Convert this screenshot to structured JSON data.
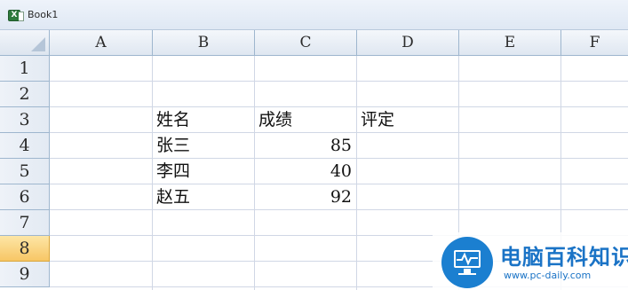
{
  "window": {
    "title": "Book1",
    "icon": "excel-workbook-icon"
  },
  "columns": [
    "A",
    "B",
    "C",
    "D",
    "E",
    "F"
  ],
  "rows": [
    "1",
    "2",
    "3",
    "4",
    "5",
    "6",
    "7",
    "8",
    "9"
  ],
  "active_row": "8",
  "cells": {
    "B3": "姓名",
    "C3": "成绩",
    "D3": "评定",
    "B4": "张三",
    "C4": "85",
    "B5": "李四",
    "C5": "40",
    "B6": "赵五",
    "C6": "92"
  },
  "watermark": {
    "name": "电脑百科知识",
    "url": "www.pc-daily.com",
    "icon": "monitor-logo-icon"
  },
  "colors": {
    "header_bg": "#dfe7f1",
    "gridline": "#d0d7e5",
    "active_row_header": "#f7c665",
    "logo": "#1a73c6"
  }
}
